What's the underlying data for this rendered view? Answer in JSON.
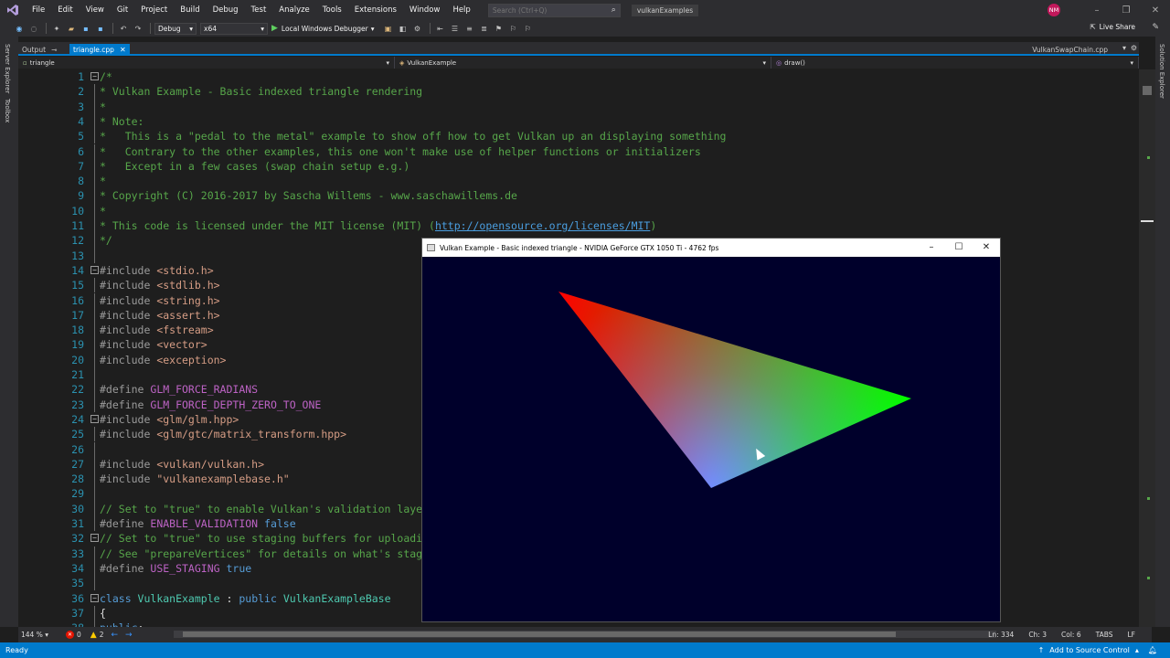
{
  "menubar": {
    "items": [
      "File",
      "Edit",
      "View",
      "Git",
      "Project",
      "Build",
      "Debug",
      "Test",
      "Analyze",
      "Tools",
      "Extensions",
      "Window",
      "Help"
    ],
    "search_placeholder": "Search (Ctrl+Q)",
    "solution_name": "vulkanExamples",
    "avatar_initials": "NM"
  },
  "toolbar": {
    "config": "Debug",
    "platform": "x64",
    "run_label": "Local Windows Debugger",
    "live_share": "Live Share"
  },
  "side_tabs": {
    "left": [
      "Server Explorer",
      "Toolbox"
    ],
    "right": [
      "Solution Explorer"
    ]
  },
  "doc_tabs": {
    "output": "Output",
    "active": "triangle.cpp",
    "right": "VulkanSwapChain.cpp"
  },
  "navbar": {
    "project": "triangle",
    "scope": "VulkanExample",
    "member": "draw()"
  },
  "code": [
    {
      "n": "1",
      "fold": "⊟",
      "spans": [
        {
          "c": "c-comment",
          "t": "/*"
        }
      ]
    },
    {
      "n": "2",
      "spans": [
        {
          "c": "c-comment",
          "t": "* Vulkan Example - Basic indexed triangle rendering"
        }
      ]
    },
    {
      "n": "3",
      "spans": [
        {
          "c": "c-comment",
          "t": "*"
        }
      ]
    },
    {
      "n": "4",
      "spans": [
        {
          "c": "c-comment",
          "t": "* Note:"
        }
      ]
    },
    {
      "n": "5",
      "spans": [
        {
          "c": "c-comment",
          "t": "*   This is a \"pedal to the metal\" example to show off how to get Vulkan up an displaying something"
        }
      ]
    },
    {
      "n": "6",
      "spans": [
        {
          "c": "c-comment",
          "t": "*   Contrary to the other examples, this one won't make use of helper functions or initializers"
        }
      ]
    },
    {
      "n": "7",
      "spans": [
        {
          "c": "c-comment",
          "t": "*   Except in a few cases (swap chain setup e.g.)"
        }
      ]
    },
    {
      "n": "8",
      "spans": [
        {
          "c": "c-comment",
          "t": "*"
        }
      ]
    },
    {
      "n": "9",
      "spans": [
        {
          "c": "c-comment",
          "t": "* Copyright (C) 2016-2017 by Sascha Willems - www.saschawillems.de"
        }
      ]
    },
    {
      "n": "10",
      "spans": [
        {
          "c": "c-comment",
          "t": "*"
        }
      ]
    },
    {
      "n": "11",
      "spans": [
        {
          "c": "c-comment",
          "t": "* This code is licensed under the MIT license (MIT) ("
        },
        {
          "c": "c-link",
          "t": "http://opensource.org/licenses/MIT"
        },
        {
          "c": "c-comment",
          "t": ")"
        }
      ]
    },
    {
      "n": "12",
      "spans": [
        {
          "c": "c-comment",
          "t": "*/"
        }
      ]
    },
    {
      "n": "13",
      "spans": []
    },
    {
      "n": "14",
      "fold": "⊟",
      "spans": [
        {
          "c": "c-pp",
          "t": "#include "
        },
        {
          "c": "c-inc",
          "t": "<stdio.h>"
        }
      ]
    },
    {
      "n": "15",
      "spans": [
        {
          "c": "c-pp",
          "t": "#include "
        },
        {
          "c": "c-inc",
          "t": "<stdlib.h>"
        }
      ]
    },
    {
      "n": "16",
      "spans": [
        {
          "c": "c-pp",
          "t": "#include "
        },
        {
          "c": "c-inc",
          "t": "<string.h>"
        }
      ]
    },
    {
      "n": "17",
      "spans": [
        {
          "c": "c-pp",
          "t": "#include "
        },
        {
          "c": "c-inc",
          "t": "<assert.h>"
        }
      ]
    },
    {
      "n": "18",
      "spans": [
        {
          "c": "c-pp",
          "t": "#include "
        },
        {
          "c": "c-inc",
          "t": "<fstream>"
        }
      ]
    },
    {
      "n": "19",
      "spans": [
        {
          "c": "c-pp",
          "t": "#include "
        },
        {
          "c": "c-inc",
          "t": "<vector>"
        }
      ]
    },
    {
      "n": "20",
      "spans": [
        {
          "c": "c-pp",
          "t": "#include "
        },
        {
          "c": "c-inc",
          "t": "<exception>"
        }
      ]
    },
    {
      "n": "21",
      "spans": []
    },
    {
      "n": "22",
      "spans": [
        {
          "c": "c-pp",
          "t": "#define "
        },
        {
          "c": "c-macro",
          "t": "GLM_FORCE_RADIANS"
        }
      ]
    },
    {
      "n": "23",
      "spans": [
        {
          "c": "c-pp",
          "t": "#define "
        },
        {
          "c": "c-macro",
          "t": "GLM_FORCE_DEPTH_ZERO_TO_ONE"
        }
      ]
    },
    {
      "n": "24",
      "fold": "⊟",
      "spans": [
        {
          "c": "c-pp",
          "t": "#include "
        },
        {
          "c": "c-inc",
          "t": "<glm/glm.hpp>"
        }
      ]
    },
    {
      "n": "25",
      "spans": [
        {
          "c": "c-pp",
          "t": "#include "
        },
        {
          "c": "c-inc",
          "t": "<glm/gtc/matrix_transform.hpp>"
        }
      ]
    },
    {
      "n": "26",
      "spans": []
    },
    {
      "n": "27",
      "spans": [
        {
          "c": "c-pp",
          "t": "#include "
        },
        {
          "c": "c-inc",
          "t": "<vulkan/vulkan.h>"
        }
      ]
    },
    {
      "n": "28",
      "spans": [
        {
          "c": "c-pp",
          "t": "#include "
        },
        {
          "c": "c-inc",
          "t": "\"vulkanexamplebase.h\""
        }
      ]
    },
    {
      "n": "29",
      "spans": []
    },
    {
      "n": "30",
      "spans": [
        {
          "c": "c-comment",
          "t": "// Set to \"true\" to enable Vulkan's validation layers"
        }
      ]
    },
    {
      "n": "31",
      "spans": [
        {
          "c": "c-pp",
          "t": "#define "
        },
        {
          "c": "c-macro",
          "t": "ENABLE_VALIDATION"
        },
        {
          "c": "c-kw",
          "t": " false"
        }
      ]
    },
    {
      "n": "32",
      "fold": "⊟",
      "spans": [
        {
          "c": "c-comment",
          "t": "// Set to \"true\" to use staging buffers for uploading vertex and index data to device local memory"
        }
      ]
    },
    {
      "n": "33",
      "spans": [
        {
          "c": "c-comment",
          "t": "// See \"prepareVertices\" for details on what's staging and on why to use it"
        }
      ]
    },
    {
      "n": "34",
      "spans": [
        {
          "c": "c-pp",
          "t": "#define "
        },
        {
          "c": "c-macro",
          "t": "USE_STAGING"
        },
        {
          "c": "c-kw",
          "t": " true"
        }
      ]
    },
    {
      "n": "35",
      "spans": []
    },
    {
      "n": "36",
      "fold": "⊟",
      "spans": [
        {
          "c": "c-kw",
          "t": "class "
        },
        {
          "c": "c-type",
          "t": "VulkanExample"
        },
        {
          "c": "c-plain",
          "t": " : "
        },
        {
          "c": "c-kw",
          "t": "public "
        },
        {
          "c": "c-type",
          "t": "VulkanExampleBase"
        }
      ]
    },
    {
      "n": "37",
      "spans": [
        {
          "c": "c-plain",
          "t": "{"
        }
      ]
    },
    {
      "n": "38",
      "spans": [
        {
          "c": "c-kw",
          "t": "public"
        },
        {
          "c": "c-plain",
          "t": ":"
        }
      ]
    }
  ],
  "bottombar": {
    "zoom": "144 %",
    "errors": "0",
    "warnings": "2",
    "line": "Ln: 334",
    "char": "Ch: 3",
    "col": "Col: 6",
    "tabs": "TABS",
    "eol": "LF"
  },
  "statusbar": {
    "ready": "Ready",
    "source_control": "Add to Source Control"
  },
  "vulkan_window": {
    "title": "Vulkan Example - Basic indexed triangle - NVIDIA GeForce GTX 1050 Ti - 4762 fps",
    "background": "#00002b"
  }
}
